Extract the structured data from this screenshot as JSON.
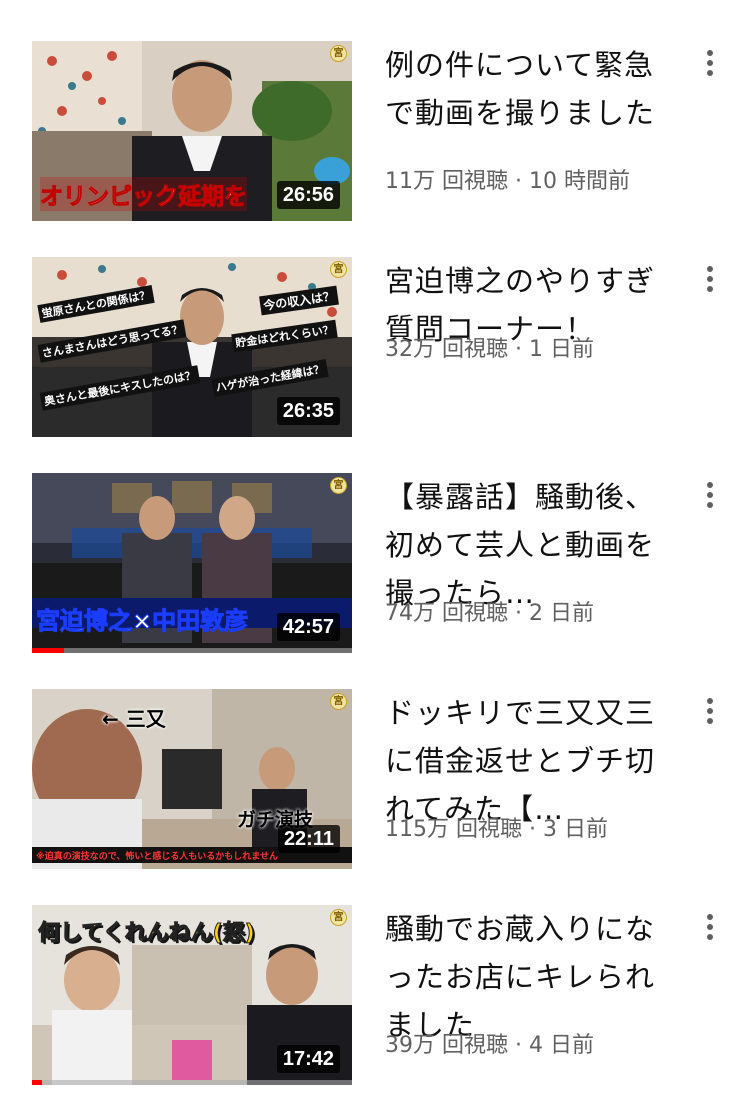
{
  "videos": [
    {
      "title": "例の件について緊急で動画を撮りました",
      "views": "11万 回視聴",
      "age": "10 時間前",
      "duration": "26:56",
      "channel_badge": "宮",
      "caption": "オリンピック延期を",
      "watched_fraction": 0
    },
    {
      "title": "宮迫博之のやりすぎ質問コーナー！",
      "views": "32万 回視聴",
      "age": "1 日前",
      "duration": "26:35",
      "channel_badge": "宮",
      "captions": [
        "蛍原さんとの関係は？",
        "今の収入は？",
        "さんまさんはどう思ってる？",
        "貯金はどれくらい？",
        "奥さんと最後にキスしたのは？",
        "ハゲが治った経緯は？"
      ],
      "watched_fraction": 0
    },
    {
      "title": "【暴露話】騒動後、初めて芸人と動画を撮ったら…",
      "views": "74万 回視聴",
      "age": "2 日前",
      "duration": "42:57",
      "channel_badge": "宮",
      "caption": "宮迫博之×中田敦彦",
      "watched_fraction": 0.1
    },
    {
      "title": "ドッキリで三又又三に借金返せとブチ切れてみた【…",
      "views": "115万 回視聴",
      "age": "3 日前",
      "duration": "22:11",
      "channel_badge": "宮",
      "caption_left": "← 三又",
      "caption_right": "ガチ演技",
      "subtitle": "※迫真の演技なので、怖いと感じる人もいるかもしれません",
      "watched_fraction": 0
    },
    {
      "title": "騒動でお蔵入りになったお店にキレられました",
      "views": "39万 回視聴",
      "age": "4 日前",
      "duration": "17:42",
      "channel_badge": "宮",
      "caption": "何してくれんねん(怒)",
      "watched_fraction": 0.03
    }
  ],
  "separator": " · ",
  "icons": {
    "more": "more-vert-icon"
  }
}
